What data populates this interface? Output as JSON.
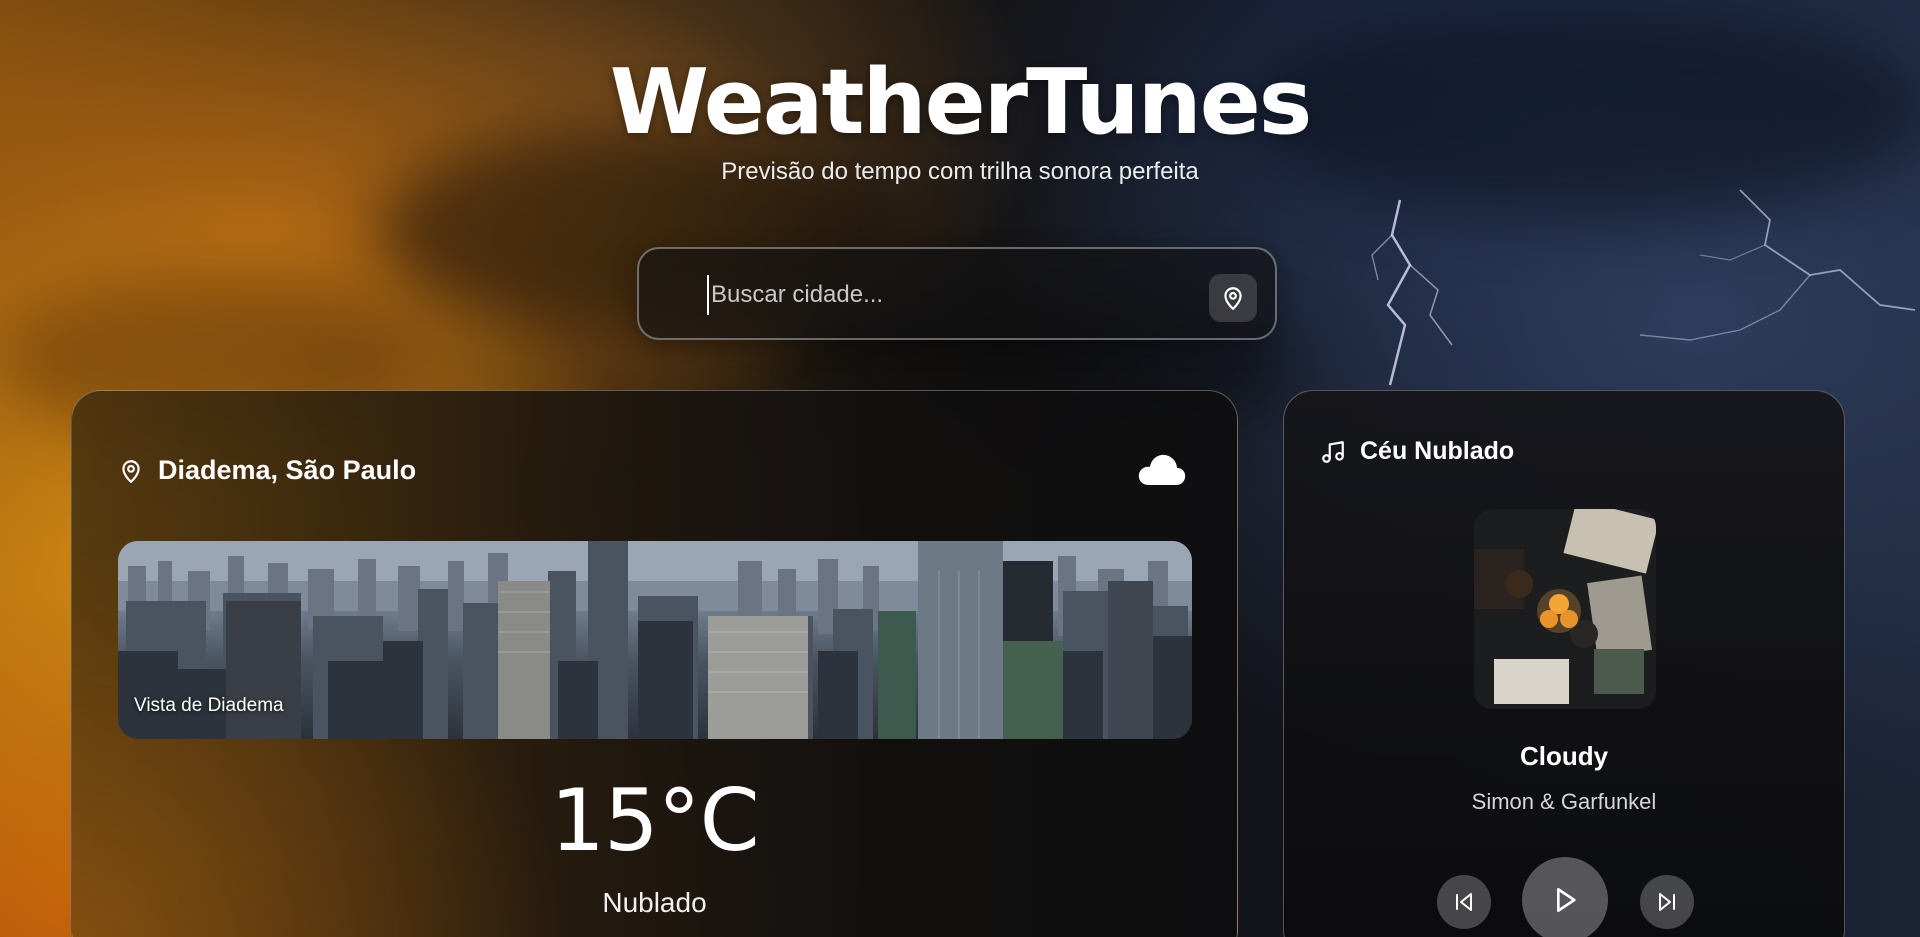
{
  "app": {
    "title": "WeatherTunes",
    "subtitle": "Previsão do tempo com trilha sonora perfeita"
  },
  "search": {
    "placeholder": "Buscar cidade...",
    "value": "",
    "locate_icon": "map-pin-icon"
  },
  "weather": {
    "location": "Diadema, São Paulo",
    "location_icon": "map-pin-icon",
    "condition_icon": "cloud-icon",
    "photo_caption": "Vista de Diadema",
    "temperature": "15°C",
    "condition": "Nublado"
  },
  "music": {
    "playlist_icon": "music-note-icon",
    "playlist_title": "Céu Nublado",
    "song_title": "Cloudy",
    "artist": "Simon & Garfunkel",
    "controls": {
      "prev_icon": "skip-back-icon",
      "play_icon": "play-icon",
      "next_icon": "skip-forward-icon"
    }
  },
  "colors": {
    "text": "#ffffff",
    "card_border": "#dcdce1",
    "storm_orange": "#d68c14",
    "night_blue": "#101522"
  }
}
